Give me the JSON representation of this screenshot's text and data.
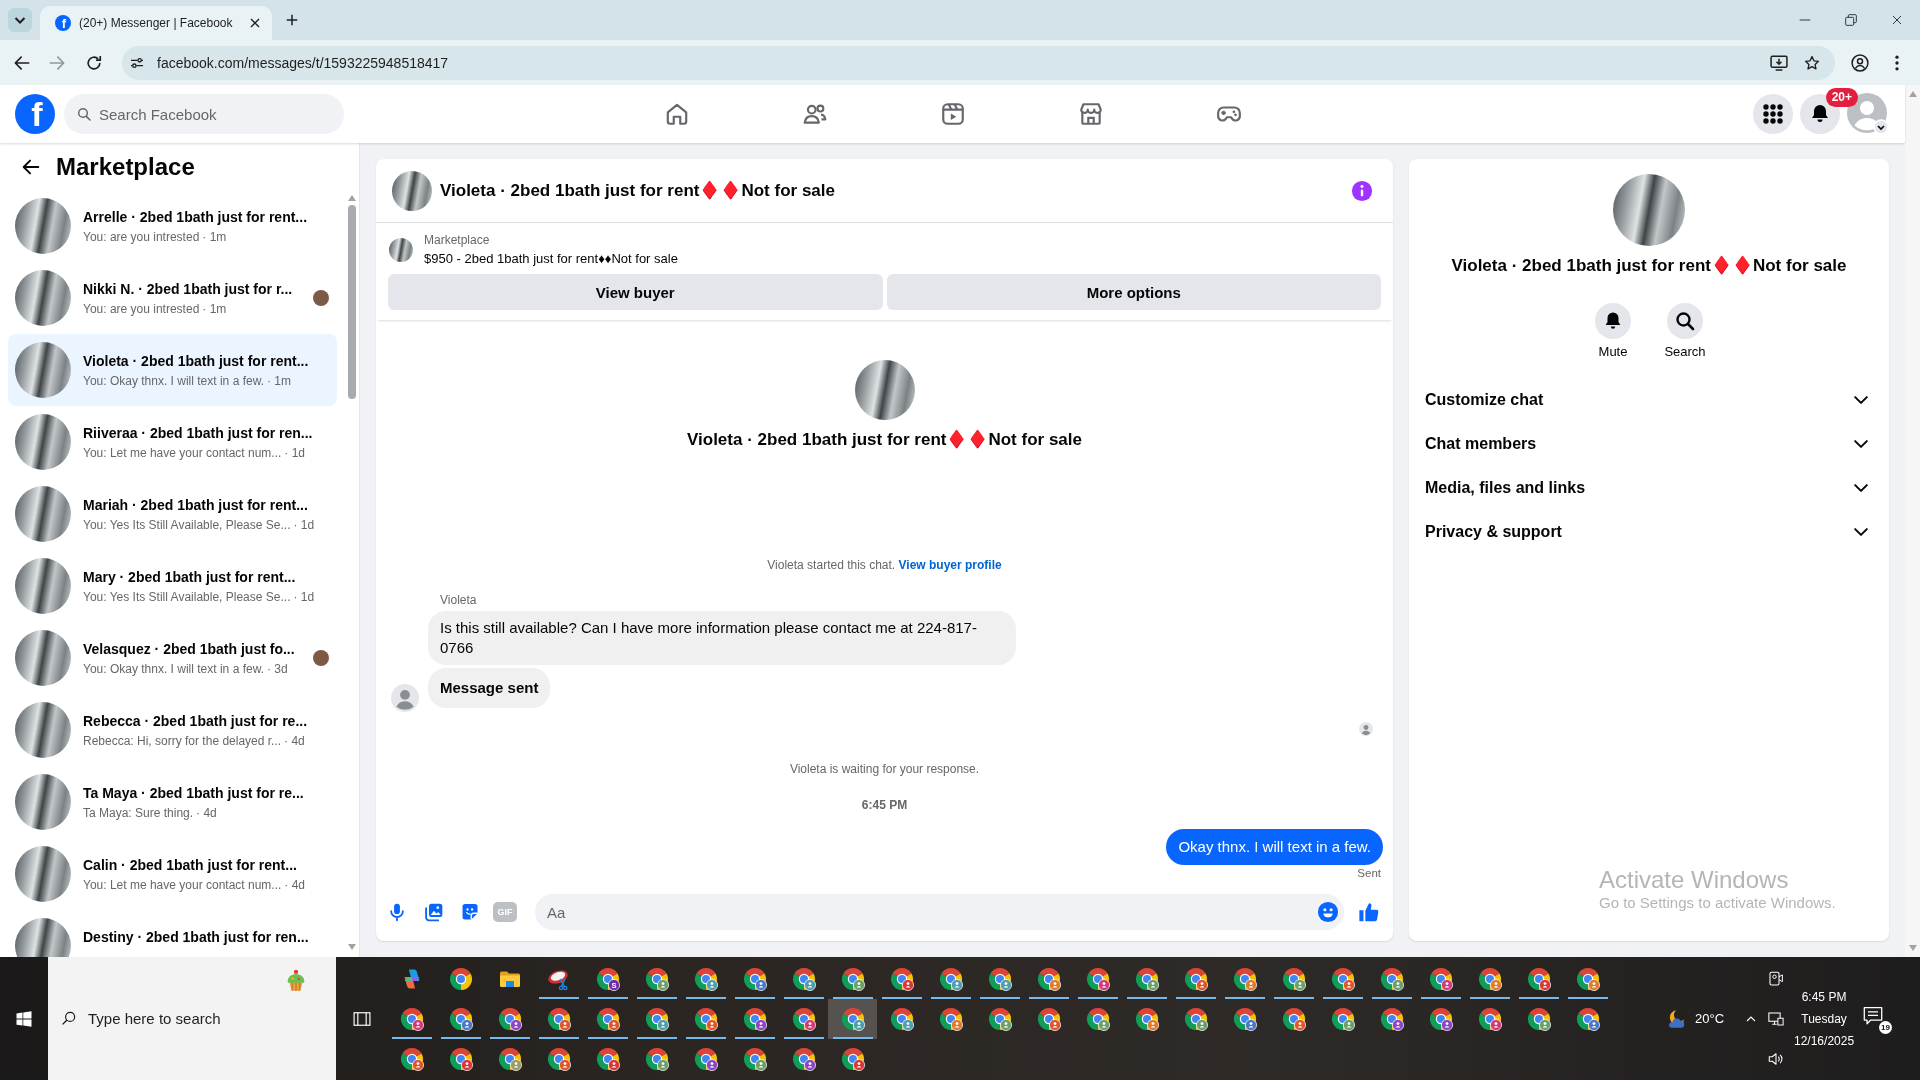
{
  "browser": {
    "tabs": [
      {
        "icon_letter": "f",
        "title": "(20+) Messenger | Facebook",
        "selected": true
      }
    ],
    "forward": {
      "disabled": true
    },
    "url": "facebook.com/messages/t/1593225948518417"
  },
  "facebook_bar": {
    "logo_letter": "f",
    "search": {
      "placeholder": "Search Facebook"
    },
    "notification_badge": "20+"
  },
  "sidebar": {
    "title": "Marketplace",
    "conversations": [
      {
        "title": "Arrelle · 2bed 1bath just for rent...",
        "preview": "You: are you intrested",
        "time": "· 1m",
        "seen": false,
        "selected": false
      },
      {
        "title": "Nikki N. · 2bed 1bath just for r...",
        "preview": "You: are you intrested",
        "time": "· 1m",
        "seen": true,
        "selected": false
      },
      {
        "title": "Violeta · 2bed 1bath just for rent...",
        "preview": "You: Okay thnx. I will text in a few.",
        "time": "· 1m",
        "seen": false,
        "selected": true
      },
      {
        "title": "Riiveraa · 2bed 1bath just for ren...",
        "preview": "You: Let me have your contact num...",
        "time": "· 1d",
        "seen": false,
        "selected": false
      },
      {
        "title": "Mariah · 2bed 1bath just for rent...",
        "preview": "You: Yes Its Still Available, Please Se...",
        "time": "· 1d",
        "seen": false,
        "selected": false
      },
      {
        "title": "Mary · 2bed 1bath just for rent...",
        "preview": "You: Yes Its Still Available, Please Se...",
        "time": "· 1d",
        "seen": false,
        "selected": false
      },
      {
        "title": "Velasquez · 2bed 1bath just fo...",
        "preview": "You: Okay thnx. I will text in a few.",
        "time": "· 3d",
        "seen": true,
        "selected": false
      },
      {
        "title": "Rebecca · 2bed 1bath just for re...",
        "preview": "Rebecca: Hi, sorry for the delayed r...",
        "time": "· 4d",
        "seen": false,
        "selected": false
      },
      {
        "title": "Ta Maya · 2bed 1bath just for re...",
        "preview": "Ta Maya: Sure thing.",
        "time": "· 4d",
        "seen": false,
        "selected": false
      },
      {
        "title": "Calin · 2bed 1bath just for rent...",
        "preview": "You: Let me have your contact num...",
        "time": "· 4d",
        "seen": false,
        "selected": false
      },
      {
        "title": "Destiny · 2bed 1bath just for ren...",
        "seen": false,
        "selected": false
      }
    ]
  },
  "chat": {
    "title": "Violeta · 2bed 1bath just for rent♦️♦️Not for sale",
    "listing": {
      "source": "Marketplace",
      "summary": "$950 - 2bed 1bath just for rent♦♦Not for sale"
    },
    "actions": [
      "View buyer",
      "More options"
    ],
    "intro_title": "Violeta · 2bed 1bath just for rent♦️♦️Not for sale",
    "timeline": [
      {
        "kind": "note",
        "text": "Violeta started this chat.",
        "link": "View buyer profile"
      },
      {
        "kind": "incoming",
        "sender": "Violeta",
        "seen": true,
        "bubbles": [
          {
            "text": "Is this still available? Can I have more information please contact me at 224-817-0766",
            "bold": false
          },
          {
            "text": "Message sent",
            "bold": true
          }
        ]
      },
      {
        "kind": "note",
        "text": "Violeta is waiting for your response."
      },
      {
        "kind": "timestamp",
        "text": "6:45 PM"
      },
      {
        "kind": "outgoing",
        "text": "Okay thnx. I will text in a few.",
        "status": "Sent"
      }
    ],
    "composer": {
      "gif_label": "GIF",
      "placeholder": "Aa"
    }
  },
  "details_panel": {
    "title": "Violeta · 2bed 1bath just for rent♦️♦️Not for sale",
    "actions": [
      {
        "kind": "mute",
        "label": "Mute"
      },
      {
        "kind": "search",
        "label": "Search"
      }
    ],
    "sections": [
      {
        "label": "Customize chat",
        "expanded": false
      },
      {
        "label": "Chat members",
        "expanded": false
      },
      {
        "label": "Media, files and links",
        "expanded": false
      },
      {
        "label": "Privacy & support",
        "expanded": false
      }
    ]
  },
  "activation_notice": {
    "title": "Activate Windows",
    "text": "Go to Settings to activate Windows."
  },
  "taskbar": {
    "search": {
      "placeholder": "Type here to search"
    },
    "apps": [
      {
        "kind": "copilot",
        "running": false,
        "active": false
      },
      {
        "kind": "chrome",
        "running": false,
        "active": false
      },
      {
        "kind": "explorer",
        "running": false,
        "active": false
      },
      {
        "kind": "snipping",
        "running": true,
        "active": false
      },
      {
        "kind": "chrome",
        "color": "#6f2da8",
        "badge": "S",
        "running": true,
        "active": false
      },
      {
        "kind": "chrome",
        "color": "#6a9f6a",
        "running": true,
        "active": false
      },
      {
        "kind": "chrome",
        "color": "#4e9fae",
        "running": true,
        "active": false
      },
      {
        "kind": "chrome",
        "color": "#4a78c9",
        "running": true,
        "active": false
      },
      {
        "kind": "chrome",
        "color": "#4e9fae",
        "running": true,
        "active": false
      },
      {
        "kind": "chrome",
        "color": "#6a9f6a",
        "running": true,
        "active": false
      },
      {
        "kind": "chrome",
        "color": "#d93636",
        "running": true,
        "active": false
      },
      {
        "kind": "chrome",
        "color": "#4e9fae",
        "running": true,
        "active": false
      },
      {
        "kind": "chrome",
        "color": "#4e9fae",
        "running": true,
        "active": false
      },
      {
        "kind": "chrome",
        "color": "#e07a2c",
        "running": true,
        "active": false
      },
      {
        "kind": "chrome",
        "color": "#d23a7a",
        "running": true,
        "active": false
      },
      {
        "kind": "chrome",
        "color": "#6a9f6a",
        "running": true,
        "active": false
      },
      {
        "kind": "chrome",
        "color": "#e0552b",
        "running": true,
        "active": false
      },
      {
        "kind": "chrome",
        "color": "#e07a2c",
        "running": true,
        "active": false
      },
      {
        "kind": "chrome",
        "color": "#6a9f6a",
        "running": true,
        "active": false
      },
      {
        "kind": "chrome",
        "color": "#e0552b",
        "running": true,
        "active": false
      },
      {
        "kind": "chrome",
        "color": "#6a9f6a",
        "running": true,
        "active": false
      },
      {
        "kind": "chrome",
        "color": "#d23a7a",
        "running": true,
        "active": false
      },
      {
        "kind": "chrome",
        "color": "#e07a2c",
        "running": true,
        "active": false
      },
      {
        "kind": "chrome",
        "color": "#d93636",
        "running": true,
        "active": false
      },
      {
        "kind": "chrome",
        "color": "#e07a2c",
        "running": true,
        "active": false
      },
      {
        "kind": "chrome",
        "color": "#d23a7a",
        "running": true,
        "active": false
      },
      {
        "kind": "chrome",
        "color": "#4a78c9",
        "running": true,
        "active": false
      },
      {
        "kind": "chrome",
        "color": "#8e44c4",
        "running": true,
        "active": false
      },
      {
        "kind": "chrome",
        "color": "#e0552b",
        "running": true,
        "active": false
      },
      {
        "kind": "chrome",
        "color": "#e0552b",
        "running": true,
        "active": false
      },
      {
        "kind": "chrome",
        "color": "#4e9fae",
        "running": true,
        "active": false
      },
      {
        "kind": "chrome",
        "color": "#e0552b",
        "running": true,
        "active": false
      },
      {
        "kind": "chrome",
        "color": "#8e44c4",
        "running": true,
        "active": false
      },
      {
        "kind": "chrome",
        "color": "#d23a7a",
        "running": true,
        "active": false
      },
      {
        "kind": "chrome",
        "color": "#4e9fae",
        "running": true,
        "active": true
      },
      {
        "kind": "chrome",
        "color": "#4e9fae",
        "running": false,
        "active": false
      },
      {
        "kind": "chrome",
        "color": "#e07a2c",
        "running": false,
        "active": false
      },
      {
        "kind": "chrome",
        "color": "#6a9f6a",
        "running": false,
        "active": false
      },
      {
        "kind": "chrome",
        "color": "#e0552b",
        "running": false,
        "active": false
      },
      {
        "kind": "chrome",
        "color": "#6a9f6a",
        "running": false,
        "active": false
      },
      {
        "kind": "chrome",
        "color": "#e07a2c",
        "running": false,
        "active": false
      },
      {
        "kind": "chrome",
        "color": "#6a9f6a",
        "running": false,
        "active": false
      },
      {
        "kind": "chrome",
        "color": "#4a78c9",
        "running": false,
        "active": false
      },
      {
        "kind": "chrome",
        "color": "#e0552b",
        "running": false,
        "active": false
      },
      {
        "kind": "chrome",
        "color": "#6a9f6a",
        "running": false,
        "active": false
      },
      {
        "kind": "chrome",
        "color": "#8e44c4",
        "running": false,
        "active": false
      },
      {
        "kind": "chrome",
        "color": "#8e44c4",
        "running": false,
        "active": false
      },
      {
        "kind": "chrome",
        "color": "#d23a7a",
        "running": false,
        "active": false
      },
      {
        "kind": "chrome",
        "color": "#6a9f6a",
        "running": false,
        "active": false
      },
      {
        "kind": "chrome",
        "color": "#4a78c9",
        "running": false,
        "active": false
      },
      {
        "kind": "chrome",
        "color": "#e0552b",
        "running": false,
        "active": false
      },
      {
        "kind": "chrome",
        "color": "#d93636",
        "running": false,
        "active": false
      },
      {
        "kind": "chrome",
        "color": "#9a9a62",
        "running": false,
        "active": false
      },
      {
        "kind": "chrome",
        "color": "#e0552b",
        "running": false,
        "active": false
      },
      {
        "kind": "chrome",
        "color": "#d93636",
        "running": false,
        "active": false
      },
      {
        "kind": "chrome",
        "color": "#6a9f6a",
        "running": false,
        "active": false
      },
      {
        "kind": "chrome",
        "color": "#8e44c4",
        "running": false,
        "active": false
      },
      {
        "kind": "chrome",
        "color": "#6a9f6a",
        "running": false,
        "active": false
      },
      {
        "kind": "chrome",
        "color": "#8e44c4",
        "running": false,
        "active": false
      },
      {
        "kind": "chrome",
        "color": "#d93636",
        "running": false,
        "active": false
      }
    ],
    "weather": "20°C",
    "time": "6:45 PM",
    "day": "Tuesday",
    "date": "12/16/2025",
    "notifications": "19"
  }
}
